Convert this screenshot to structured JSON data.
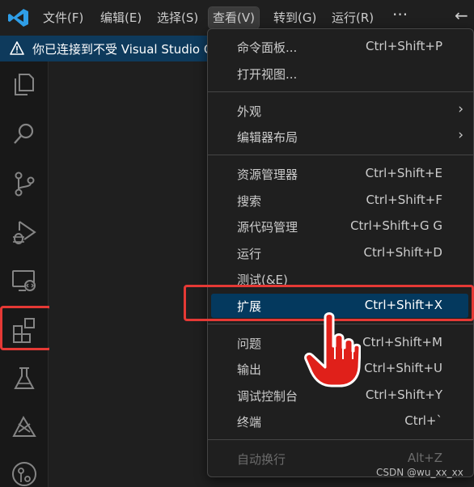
{
  "titlebar": {
    "menu": [
      {
        "label": "文件(F)"
      },
      {
        "label": "编辑(E)"
      },
      {
        "label": "选择(S)"
      },
      {
        "label": "查看(V)"
      },
      {
        "label": "转到(G)"
      },
      {
        "label": "运行(R)"
      }
    ],
    "more": "···",
    "back": "←"
  },
  "banner": {
    "icon": "warning-icon",
    "text": "你已连接到不受 Visual Studio Co"
  },
  "activitybar": {
    "items": [
      "explorer-icon",
      "search-icon",
      "source-control-icon",
      "run-debug-icon",
      "remote-explorer-icon",
      "extensions-icon",
      "testing-icon",
      "deploy-icon",
      "git-graph-icon"
    ]
  },
  "view_menu": {
    "items": [
      {
        "label": "命令面板...",
        "shortcut": "Ctrl+Shift+P"
      },
      {
        "label": "打开视图...",
        "shortcut": ""
      },
      {
        "label": "外观",
        "shortcut": "",
        "submenu": "›"
      },
      {
        "label": "编辑器布局",
        "shortcut": "",
        "submenu": "›"
      },
      {
        "label": "资源管理器",
        "shortcut": "Ctrl+Shift+E"
      },
      {
        "label": "搜索",
        "shortcut": "Ctrl+Shift+F"
      },
      {
        "label": "源代码管理",
        "shortcut": "Ctrl+Shift+G G"
      },
      {
        "label": "运行",
        "shortcut": "Ctrl+Shift+D"
      },
      {
        "label": "测试(&E)",
        "shortcut": ""
      },
      {
        "label": "扩展",
        "shortcut": "Ctrl+Shift+X",
        "selected": true
      },
      {
        "label": "问题",
        "shortcut": "Ctrl+Shift+M"
      },
      {
        "label": "输出",
        "shortcut": "Ctrl+Shift+U"
      },
      {
        "label": "调试控制台",
        "shortcut": "Ctrl+Shift+Y"
      },
      {
        "label": "终端",
        "shortcut": "Ctrl+`"
      },
      {
        "label": "自动换行",
        "shortcut": "Alt+Z",
        "disabled": true
      }
    ]
  },
  "watermark": "CSDN @wu_xx_xx",
  "colors": {
    "accent": "#007acc",
    "selection": "#04395e",
    "highlight_box": "#e53935",
    "banner": "#0e3a5c"
  }
}
